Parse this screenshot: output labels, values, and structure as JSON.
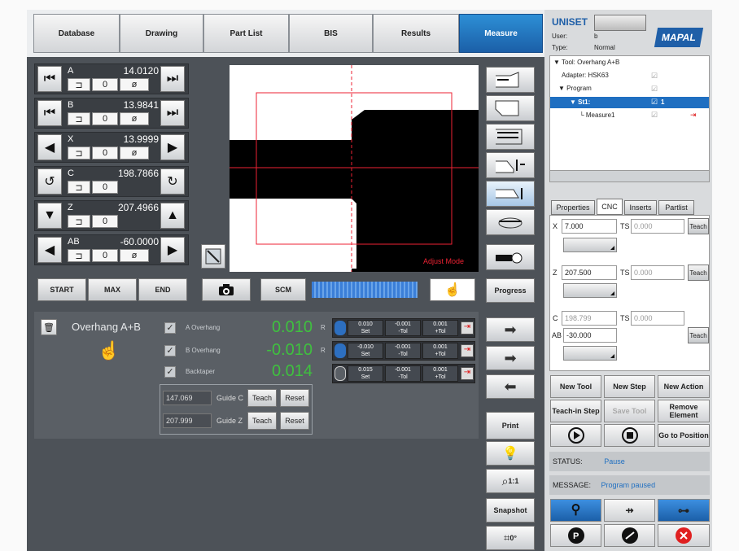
{
  "tabs": [
    "Database",
    "Drawing",
    "Part List",
    "BIS",
    "Results",
    "Measure"
  ],
  "active_tab": "Measure",
  "header": {
    "brand": "UNISET",
    "user_label": "User:",
    "user_value": "b",
    "type_label": "Type:",
    "type_value": "Normal",
    "logo": "MAPAL"
  },
  "axes": [
    {
      "name": "A",
      "value": "14.0120",
      "index": "0",
      "phi": "ø"
    },
    {
      "name": "B",
      "value": "13.9841",
      "index": "0",
      "phi": "ø"
    },
    {
      "name": "X",
      "value": "13.9999",
      "index": "0",
      "phi": "ø"
    },
    {
      "name": "C",
      "value": "198.7866",
      "index": "0",
      "phi": ""
    },
    {
      "name": "Z",
      "value": "207.4966",
      "index": "0",
      "phi": ""
    },
    {
      "name": "AB",
      "value": "-60.0000",
      "index": "0",
      "phi": "ø"
    }
  ],
  "nav_buttons": {
    "start": "START",
    "max": "MAX",
    "end": "END",
    "scm": "SCM",
    "progress": "Progress"
  },
  "image_view": {
    "mode_label": "Adjust Mode"
  },
  "measure": {
    "title": "Overhang A+B",
    "rows": [
      {
        "label": "A Overhang",
        "value": "0.010",
        "flag": "R",
        "nominal": "0.010",
        "neg_tol": "-0.001",
        "pos_tol": "0.001",
        "set": "Set",
        "ntol": "-Tol",
        "ptol": "+Tol"
      },
      {
        "label": "B Overhang",
        "value": "-0.010",
        "flag": "R",
        "nominal": "-0.010",
        "neg_tol": "-0.001",
        "pos_tol": "0.001",
        "set": "Set",
        "ntol": "-Tol",
        "ptol": "+Tol"
      },
      {
        "label": "Backtaper",
        "value": "0.014",
        "flag": "",
        "nominal": "0.015",
        "neg_tol": "-0.001",
        "pos_tol": "0.001",
        "set": "Set",
        "ntol": "-Tol",
        "ptol": "+Tol"
      }
    ],
    "guides": [
      {
        "value": "147.069",
        "label": "Guide C",
        "teach": "Teach",
        "reset": "Reset"
      },
      {
        "value": "207.999",
        "label": "Guide Z",
        "teach": "Teach",
        "reset": "Reset"
      }
    ]
  },
  "right_side_buttons": {
    "print": "Print",
    "zoom": "1:1",
    "snapshot": "Snapshot",
    "rotate": "0°"
  },
  "tree": [
    {
      "label": "Tool: Overhang A+B",
      "level": 0
    },
    {
      "label": "Adapter: HSK63",
      "level": 1
    },
    {
      "label": "Program",
      "level": 1
    },
    {
      "label": "St1:",
      "level": 2,
      "extra": "1"
    },
    {
      "label": "Measure1",
      "level": 3
    }
  ],
  "prop_tabs": [
    "Properties",
    "CNC",
    "Inserts",
    "Partlist"
  ],
  "cnc": {
    "x_label": "X",
    "x_value": "7.000",
    "x_ts_label": "TS",
    "x_ts": "0.000",
    "z_label": "Z",
    "z_value": "207.500",
    "z_ts_label": "TS",
    "z_ts": "0.000",
    "c_label": "C",
    "c_value": "198.799",
    "c_ts_label": "TS",
    "c_ts": "0.000",
    "ab_label": "AB",
    "ab_value": "-30.000",
    "teach": "Teach"
  },
  "actions": {
    "new_tool": "New Tool",
    "new_step": "New Step",
    "new_action": "New Action",
    "teach_in_step": "Teach-in Step",
    "save_tool": "Save Tool",
    "remove_element": "Remove Element",
    "go_to_position": "Go to Position"
  },
  "status": {
    "status_label": "STATUS:",
    "status_value": "Pause",
    "message_label": "MESSAGE:",
    "message_value": "Program paused"
  },
  "colors": {
    "accent": "#1f6fc1",
    "green": "#3fc13f",
    "red_stop": "#e02020",
    "panel": "#4d5258"
  }
}
